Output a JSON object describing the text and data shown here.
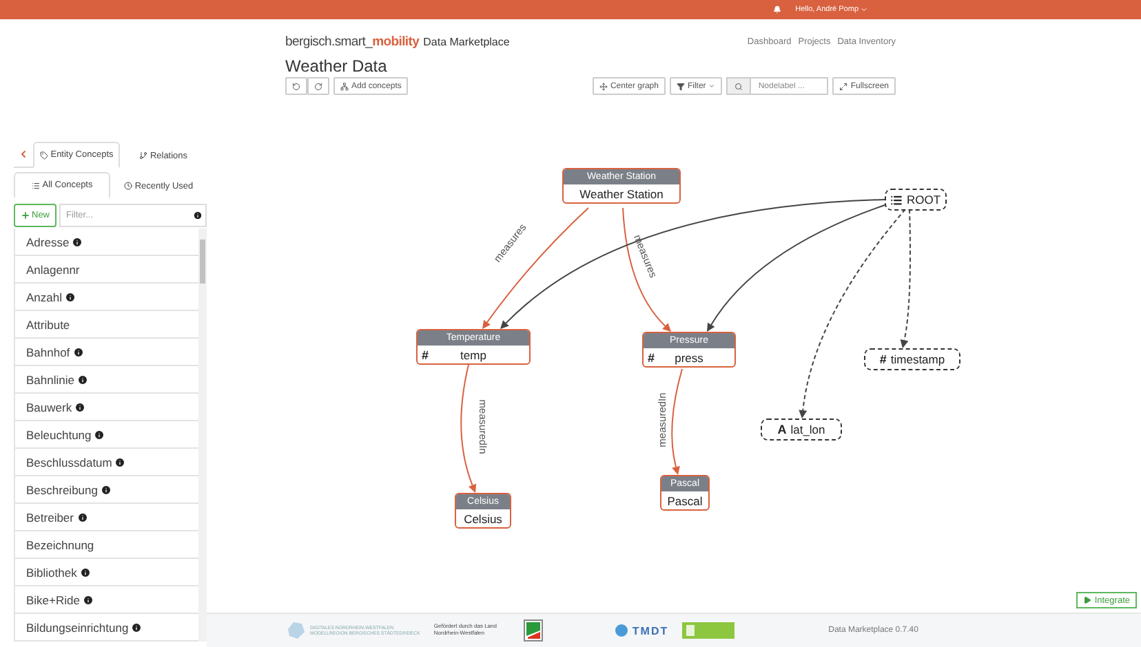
{
  "top_bar": {
    "user": "Hello, André Pomp"
  },
  "header": {
    "brand_prefix": "bergisch.smart_",
    "brand_highlight": "mobility",
    "product": "Data Marketplace",
    "nav": [
      "Dashboard",
      "Projects",
      "Data Inventory"
    ],
    "title": "Weather Data"
  },
  "toolbar": {
    "add": "Add concepts",
    "center": "Center graph",
    "filter": "Filter",
    "search_placeholder": "Nodelabel ...",
    "fullscreen": "Fullscreen"
  },
  "sidebar": {
    "tabs": [
      {
        "label": "Entity Concepts",
        "selected": true
      },
      {
        "label": "Relations",
        "selected": false
      }
    ],
    "subtabs": [
      {
        "label": "All Concepts",
        "selected": true
      },
      {
        "label": "Recently Used",
        "selected": false
      }
    ],
    "new_button": "New",
    "filter_placeholder": "Filter...",
    "items": [
      {
        "name": "Adresse",
        "info": true
      },
      {
        "name": "Anlagennr",
        "info": false
      },
      {
        "name": "Anzahl",
        "info": true
      },
      {
        "name": "Attribute",
        "info": false
      },
      {
        "name": "Bahnhof",
        "info": true
      },
      {
        "name": "Bahnlinie",
        "info": true
      },
      {
        "name": "Bauwerk",
        "info": true
      },
      {
        "name": "Beleuchtung",
        "info": true
      },
      {
        "name": "Beschlussdatum",
        "info": true
      },
      {
        "name": "Beschreibung",
        "info": true
      },
      {
        "name": "Betreiber",
        "info": true
      },
      {
        "name": "Bezeichnung",
        "info": false
      },
      {
        "name": "Bibliothek",
        "info": true
      },
      {
        "name": "Bike+Ride",
        "info": true
      },
      {
        "name": "Bildungseinrichtung",
        "info": true
      }
    ]
  },
  "graph": {
    "nodes": [
      {
        "kind": "concept",
        "title": "Weather Station",
        "label": "Weather Station"
      },
      {
        "kind": "concept",
        "title": "Temperature",
        "symbol": "#",
        "label": "temp"
      },
      {
        "kind": "concept",
        "title": "Pressure",
        "symbol": "#",
        "label": "press"
      },
      {
        "kind": "concept",
        "title": "Celsius",
        "label": "Celsius"
      },
      {
        "kind": "concept",
        "title": "Pascal",
        "label": "Pascal"
      },
      {
        "kind": "root",
        "label": "ROOT"
      },
      {
        "kind": "field",
        "symbol": "#",
        "label": "timestamp"
      },
      {
        "kind": "field",
        "symbol": "A",
        "label": "lat_lon"
      }
    ],
    "edges": [
      {
        "kind": "relation",
        "label": "measures"
      },
      {
        "kind": "relation",
        "label": "measures"
      },
      {
        "kind": "relation",
        "label": "measuredIn"
      },
      {
        "kind": "relation",
        "label": "measuredIn"
      },
      {
        "kind": "link"
      },
      {
        "kind": "link"
      },
      {
        "kind": "optional"
      },
      {
        "kind": "optional"
      }
    ]
  },
  "integrate_button": "Integrate",
  "footer": {
    "logo_line_1": "DIGITALES NORDRHEIN-WESTFALEN",
    "logo_line_2": "MODELLREGION BERGISCHES STÄDTEDREIECK",
    "funding": "Gefördert durch das Land Nordrhein-Westfalen",
    "partner": "TMDT",
    "version": "Data Marketplace 0.7.40"
  }
}
